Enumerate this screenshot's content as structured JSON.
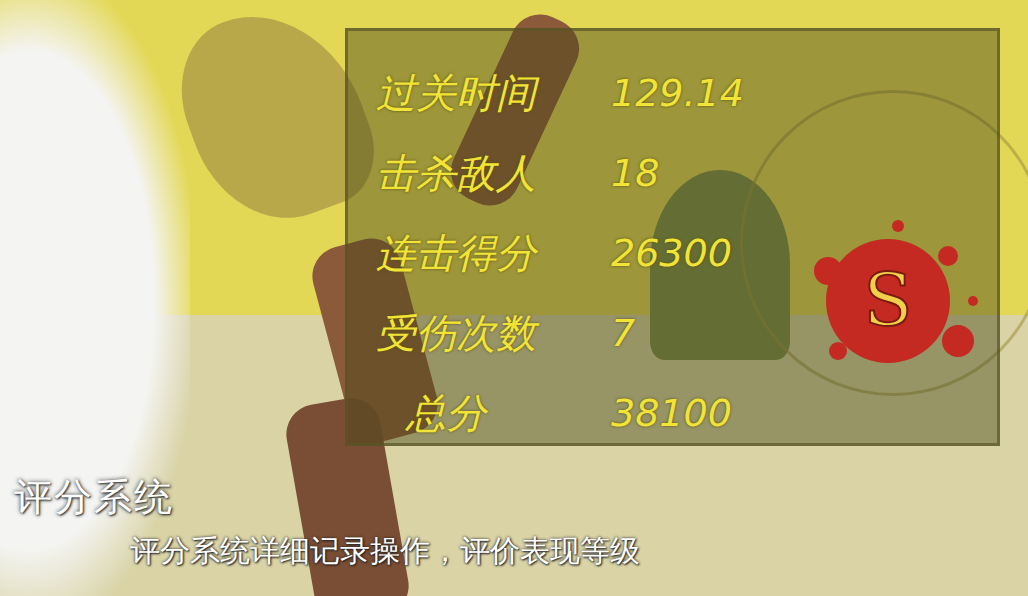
{
  "score_panel": {
    "rows": [
      {
        "label": "过关时间",
        "value": "129.14"
      },
      {
        "label": "击杀敌人",
        "value": "18"
      },
      {
        "label": "连击得分",
        "value": "26300"
      },
      {
        "label": "受伤次数",
        "value": "7"
      },
      {
        "label": "总分",
        "value": "38100"
      }
    ],
    "rank": "S"
  },
  "caption": {
    "title": "评分系统",
    "subtitle": "评分系统详细记录操作，评价表现等级"
  }
}
